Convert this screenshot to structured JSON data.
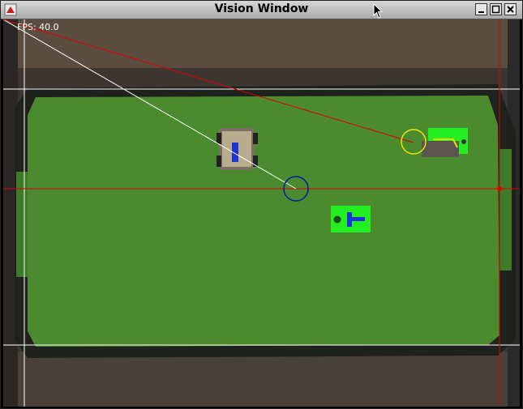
{
  "window": {
    "title": "Vision Window",
    "buttons": {
      "minimize": "minimize-icon",
      "maximize": "maximize-icon",
      "close": "close-icon"
    }
  },
  "overlay": {
    "fps_text": "FPS: 40.0"
  },
  "colors": {
    "field": "#4b8a2e",
    "robot_marker": "#22ee22",
    "ball_circle": "#0a1aa0",
    "target_circle": "#e8e800",
    "red_line": "#e00000",
    "white_line": "#ffffff"
  }
}
